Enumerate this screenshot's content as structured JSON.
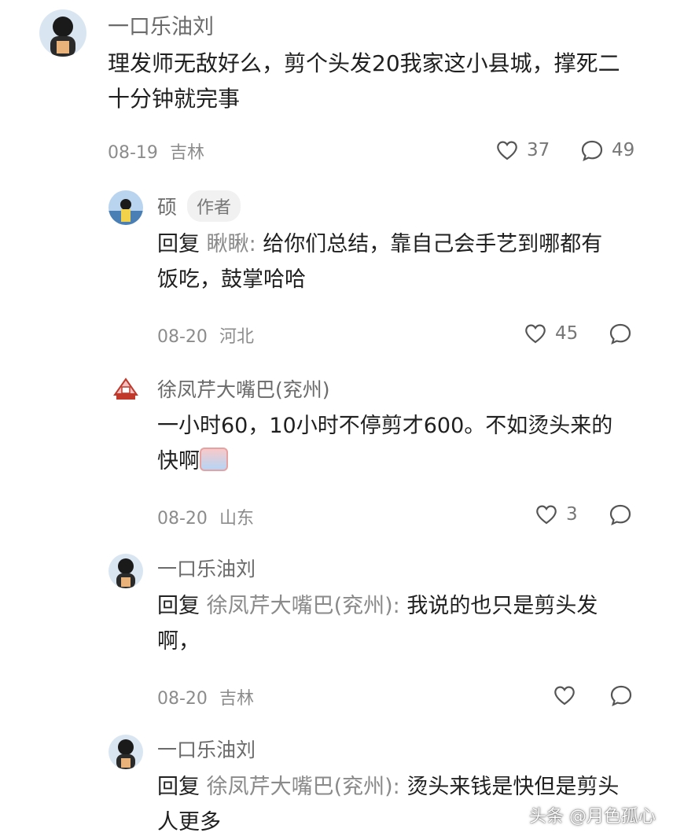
{
  "comments": [
    {
      "name": "一口乐油刘",
      "text": "理发师无敌好么，剪个头发20我家这小县城，撑死二十分钟就完事",
      "date": "08-19",
      "location": "吉林",
      "likes": "37",
      "replies": "49"
    },
    {
      "name": "硕",
      "badge": "作者",
      "reply_prefix": "回复",
      "reply_target": "瞅瞅:",
      "text": "给你们总结，靠自己会手艺到哪都有饭吃，鼓掌哈哈",
      "date": "08-20",
      "location": "河北",
      "likes": "45"
    },
    {
      "name": "徐凤芹大嘴巴(兖州)",
      "text": "一小时60，10小时不停剪才600。不如烫头来的快啊",
      "date": "08-20",
      "location": "山东",
      "likes": "3"
    },
    {
      "name": "一口乐油刘",
      "reply_prefix": "回复",
      "reply_target": "徐凤芹大嘴巴(兖州):",
      "text": "我说的也只是剪头发啊，",
      "date": "08-20",
      "location": "吉林"
    },
    {
      "name": "一口乐油刘",
      "reply_prefix": "回复",
      "reply_target": "徐凤芹大嘴巴(兖州):",
      "text": "烫头来钱是快但是剪头人更多"
    }
  ],
  "watermark": "头条 @月色孤心",
  "colors": {
    "name": "#6b6b6b",
    "meta": "#8c8c8c",
    "text": "#1f1f1f"
  }
}
